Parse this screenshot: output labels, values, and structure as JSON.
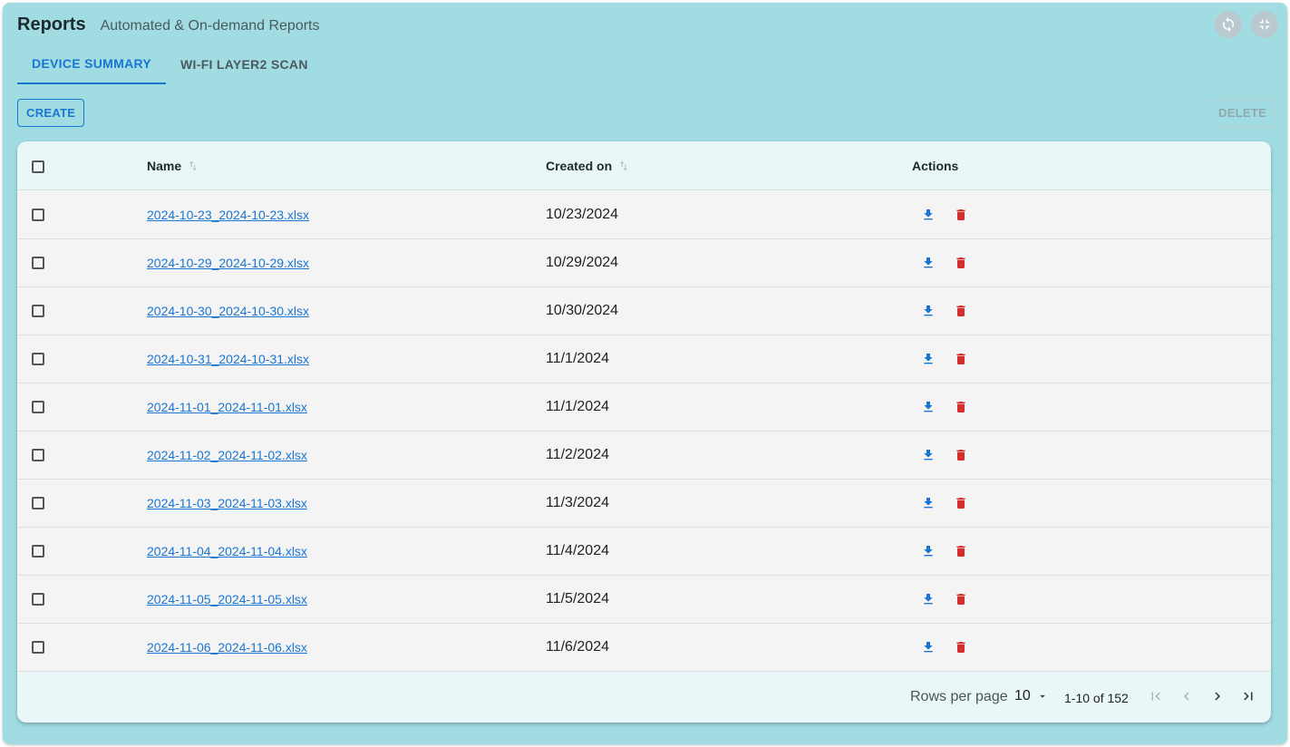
{
  "header": {
    "title": "Reports",
    "subtitle": "Automated & On-demand Reports"
  },
  "tabs": [
    {
      "label": "DEVICE SUMMARY",
      "active": true
    },
    {
      "label": "WI-FI LAYER2 SCAN",
      "active": false
    }
  ],
  "toolbar": {
    "create_label": "CREATE",
    "delete_label": "DELETE"
  },
  "table": {
    "columns": {
      "name": "Name",
      "created_on": "Created on",
      "actions": "Actions"
    },
    "rows": [
      {
        "name": "2024-10-23_2024-10-23.xlsx",
        "created_on": "10/23/2024"
      },
      {
        "name": "2024-10-29_2024-10-29.xlsx",
        "created_on": "10/29/2024"
      },
      {
        "name": "2024-10-30_2024-10-30.xlsx",
        "created_on": "10/30/2024"
      },
      {
        "name": "2024-10-31_2024-10-31.xlsx",
        "created_on": "11/1/2024"
      },
      {
        "name": "2024-11-01_2024-11-01.xlsx",
        "created_on": "11/1/2024"
      },
      {
        "name": "2024-11-02_2024-11-02.xlsx",
        "created_on": "11/2/2024"
      },
      {
        "name": "2024-11-03_2024-11-03.xlsx",
        "created_on": "11/3/2024"
      },
      {
        "name": "2024-11-04_2024-11-04.xlsx",
        "created_on": "11/4/2024"
      },
      {
        "name": "2024-11-05_2024-11-05.xlsx",
        "created_on": "11/5/2024"
      },
      {
        "name": "2024-11-06_2024-11-06.xlsx",
        "created_on": "11/6/2024"
      }
    ]
  },
  "pagination": {
    "rows_per_page_label": "Rows per page",
    "rows_per_page": "10",
    "range": "1-10 of 152"
  },
  "colors": {
    "accent": "#1976d2",
    "danger": "#d32f2f",
    "background": "#a0dce2"
  },
  "icons": {
    "refresh": "refresh-icon",
    "collapse": "collapse-icon",
    "download": "download-icon",
    "delete": "trash-icon",
    "sort": "sort-icon",
    "first_page": "first-page-icon",
    "prev_page": "chevron-left-icon",
    "next_page": "chevron-right-icon",
    "last_page": "last-page-icon"
  }
}
